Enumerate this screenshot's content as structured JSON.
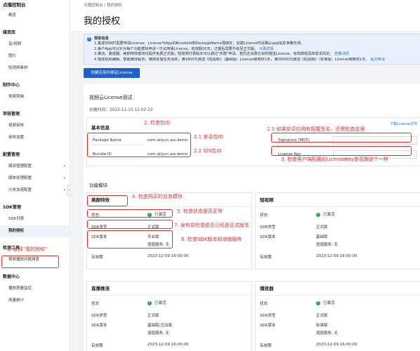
{
  "sidebar": {
    "title": "点播控制台",
    "items": [
      {
        "type": "item",
        "label": "概览"
      },
      {
        "type": "sep"
      },
      {
        "type": "group",
        "label": "媒资库"
      },
      {
        "type": "item",
        "label": "音/视频"
      },
      {
        "type": "item",
        "label": "图片"
      },
      {
        "type": "item",
        "label": "短视频素材"
      },
      {
        "type": "sep"
      },
      {
        "type": "group",
        "label": "制作中心"
      },
      {
        "type": "item",
        "label": "视频剪辑"
      },
      {
        "type": "sep"
      },
      {
        "type": "group",
        "label": "审核管理"
      },
      {
        "type": "item",
        "label": "视频审核"
      },
      {
        "type": "item",
        "label": "审核设置"
      },
      {
        "type": "sep"
      },
      {
        "type": "group",
        "label": "配置管理"
      },
      {
        "type": "item",
        "label": "媒资管理配置",
        "chev": true
      },
      {
        "type": "item",
        "label": "媒体处理配置",
        "chev": true
      },
      {
        "type": "item",
        "label": "分发加速配置",
        "chev": true
      },
      {
        "type": "sep"
      },
      {
        "type": "group",
        "label": "SDK管理"
      },
      {
        "type": "item",
        "label": "SDK列表"
      },
      {
        "type": "item",
        "label": "我的授权",
        "active": true
      },
      {
        "type": "sep"
      },
      {
        "type": "group",
        "label": "检测工具"
      },
      {
        "type": "item",
        "label": "视频播放问题排查"
      },
      {
        "type": "sep"
      },
      {
        "type": "group",
        "label": "数据中心"
      },
      {
        "type": "item",
        "label": "播放质量监控"
      },
      {
        "type": "item",
        "label": "用量统计"
      }
    ]
  },
  "breadcrumb": "点播控制台 / 我的授权",
  "page_title": "我的授权",
  "notice": {
    "heading": "帮助信息",
    "line1": "1.集成SDK时需要申请License：License与App的BundleId和PackageName强绑定，创建License时请确认app信息准确无误。",
    "line2a": "2.每个App可以针对每个功能模块申请一次试用版License，有效期30天；过期后需要升级至正式版。",
    "line2b": "计费详情",
    "line3a": "3.推流、播放器、美颜特效模块均提供免费正式版；短视频付费版本可以通过\"实赠\"申请，若历史消费达标则赠送License，有效期视具体需求而定。",
    "line3b": "查看详情",
    "line4a": "4.智能视频编辑、智能媒体服务，媒体处理任务消费，满1800元赠送《短视频》（基础版）License使用权1年，满30000元赠送《短视频》（标准版）License使用权1年。",
    "line4b": "提交申请"
  },
  "create_button": "创建应用并绑定License",
  "panel": {
    "title": "视频云License测试",
    "created": "创建时间：2022-11-10 12:02:32",
    "basic_title": "基本信息",
    "download": "下载License文件",
    "package_label": "Package Name",
    "package_value": "com.aliyun.aio.demo",
    "bundle_label": "Bundle ID",
    "bundle_value": "com.aliyun.aio.demo",
    "signature_label": "Signature (MD5)",
    "license_key_label": "License Key",
    "func_title": "功能模块"
  },
  "cards": {
    "beauty": {
      "title": "美颜特效",
      "status_label": "状态",
      "status": "已激活",
      "type_label": "SDK类型",
      "type": "正式版",
      "version_label": "SDK版本",
      "version1": "专业版",
      "version2": "增值服务: 无",
      "expiry_label": "有效期",
      "expiry": "2023-12-09 16:00:00"
    },
    "short_video": {
      "title": "短视频",
      "status_label": "状态",
      "status": "已激活",
      "type_label": "SDK类型",
      "type": "正式版",
      "version_label": "SDK版本",
      "version1": "基础版",
      "version2": "增值服务: 无",
      "expiry_label": "有效期",
      "expiry": "2023-12-09 16:00:00"
    },
    "live_push": {
      "title": "直播推流",
      "status_label": "状态",
      "status": "已激活",
      "type_label": "SDK类型",
      "type": "正式版",
      "version_label": "SDK版本",
      "version1": "基础版/互动版",
      "version2": "增值服务: 无",
      "expiry_label": "有效期",
      "expiry": "2023-12-09 16:00:00"
    },
    "player": {
      "title": "播放器",
      "status_label": "状态",
      "status": "已激活",
      "type_label": "SDK类型",
      "type": "正式版",
      "version_label": "SDK版本",
      "version1": "标准版",
      "version2": "增值服务: 无",
      "expiry_label": "有效期",
      "expiry": "2023-12-09 16:00:00"
    }
  },
  "annotations": {
    "a1": "1. 选择\"我的授权\"",
    "a2": "2. 检查包ID",
    "a21": "2.1 安卓包ID",
    "a22": "2.2 iOS包ID",
    "a23": "2.3 如果安卓应用有配置签名，还需检查这里",
    "a3": "3. 检查客户端配置的LicenseKey是否跟这个一样",
    "a4": "4. 检查购买的业务模块",
    "a5": "5. 检查状态是否正常",
    "a6": "6. 检查SDK版本和增值服务",
    "a7": "7. 发布前检查是否已经是正式版本"
  },
  "colors": {
    "accent": "#1e5fcc",
    "annotation": "#e03131",
    "success": "#27a844"
  }
}
